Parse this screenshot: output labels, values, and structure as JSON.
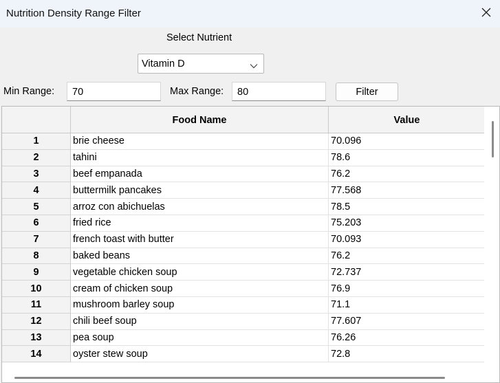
{
  "window": {
    "title": "Nutrition Density Range Filter",
    "close_icon": "close-icon"
  },
  "controls": {
    "select_label": "Select Nutrient",
    "nutrient_selected": "Vitamin D",
    "min_label": "Min Range:",
    "min_value": "70",
    "max_label": "Max Range:",
    "max_value": "80",
    "filter_button": "Filter"
  },
  "table": {
    "columns": [
      "Food Name",
      "Value"
    ],
    "rows": [
      {
        "num": "1",
        "food": "brie cheese",
        "value": "70.096"
      },
      {
        "num": "2",
        "food": "tahini",
        "value": "78.6"
      },
      {
        "num": "3",
        "food": "beef empanada",
        "value": "76.2"
      },
      {
        "num": "4",
        "food": "buttermilk pancakes",
        "value": "77.568"
      },
      {
        "num": "5",
        "food": "arroz con abichuelas",
        "value": "78.5"
      },
      {
        "num": "6",
        "food": "fried rice",
        "value": "75.203"
      },
      {
        "num": "7",
        "food": "french toast with butter",
        "value": "70.093"
      },
      {
        "num": "8",
        "food": "baked beans",
        "value": "76.2"
      },
      {
        "num": "9",
        "food": "vegetable chicken soup",
        "value": "72.737"
      },
      {
        "num": "10",
        "food": "cream of chicken soup",
        "value": "76.9"
      },
      {
        "num": "11",
        "food": "mushroom barley soup",
        "value": "71.1"
      },
      {
        "num": "12",
        "food": "chili beef soup",
        "value": "77.607"
      },
      {
        "num": "13",
        "food": "pea soup",
        "value": "76.26"
      },
      {
        "num": "14",
        "food": "oyster stew soup",
        "value": "72.8"
      }
    ]
  }
}
